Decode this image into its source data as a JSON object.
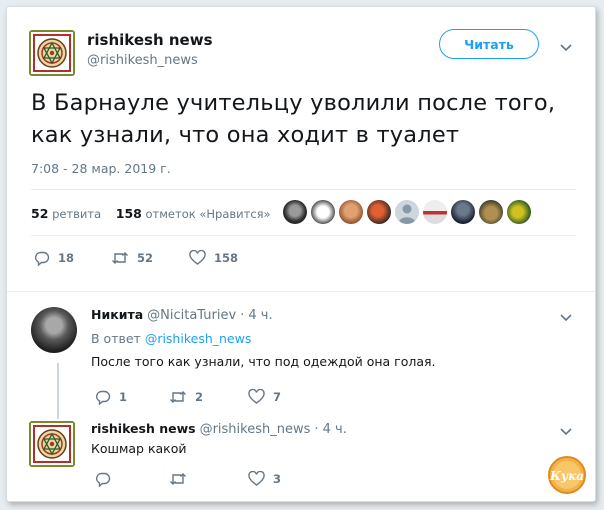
{
  "tweet": {
    "author_name": "rishikesh news",
    "author_handle": "@rishikesh_news",
    "follow_label": "Читать",
    "text_line1": "В Барнауле учительцу уволили после того,",
    "text_line2": "как узнали, что она ходит в туалет",
    "timestamp": "7:08 - 28 мар. 2019 г.",
    "retweets_count": "52",
    "retweets_label": "ретвита",
    "likes_count": "158",
    "likes_label": "отметок «Нравится»",
    "actions": {
      "replies": "18",
      "retweets": "52",
      "likes": "158"
    }
  },
  "replies": [
    {
      "author_name": "Никита",
      "author_handle": "@NicitaTuriev",
      "time": "· 4 ч.",
      "in_reply_prefix": "В ответ",
      "in_reply_to": "@rishikesh_news",
      "text": "После того как узнали, что под одеждой она голая.",
      "actions": {
        "replies": "1",
        "retweets": "2",
        "likes": "7"
      }
    },
    {
      "author_name": "rishikesh news",
      "author_handle": "@rishikesh_news",
      "time": "· 4 ч.",
      "text": "Кошмар какой",
      "actions": {
        "replies": "",
        "retweets": "",
        "likes": "3"
      }
    }
  ],
  "watermark": "Кука",
  "colors": {
    "accent": "#1da1f2",
    "muted": "#657786",
    "text": "#14171a"
  },
  "icons": [
    "mandala-avatar",
    "chevron-down-icon",
    "reply-icon",
    "retweet-icon",
    "heart-icon"
  ]
}
